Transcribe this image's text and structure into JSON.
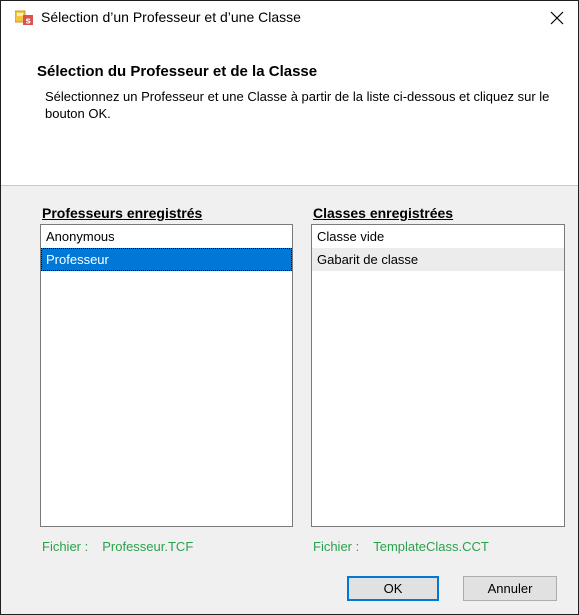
{
  "window": {
    "title": "Sélection d’un Professeur et d’une Classe"
  },
  "header": {
    "title": "Sélection du Professeur et de la Classe",
    "description": "Sélectionnez un Professeur et une Classe à partir de la liste ci-dessous et cliquez sur le bouton OK."
  },
  "teachers": {
    "label": "Professeurs enregistrés",
    "items": [
      "Anonymous",
      "Professeur"
    ],
    "selected": "Professeur",
    "file_label": "Fichier :",
    "file_name": "Professeur.TCF"
  },
  "classes": {
    "label": "Classes enregistrées",
    "items": [
      "Classe vide",
      "Gabarit de classe"
    ],
    "hovered": "Gabarit de classe",
    "file_label": "Fichier :",
    "file_name": "TemplateClass.CCT"
  },
  "buttons": {
    "ok_label": "OK",
    "cancel_label": "Annuler"
  },
  "colors": {
    "selection": "#0078d7",
    "file_text": "#2aa24c",
    "dialog_bg": "#f0f0f0"
  },
  "icons": {
    "app": "app-icon",
    "close": "close-icon"
  }
}
